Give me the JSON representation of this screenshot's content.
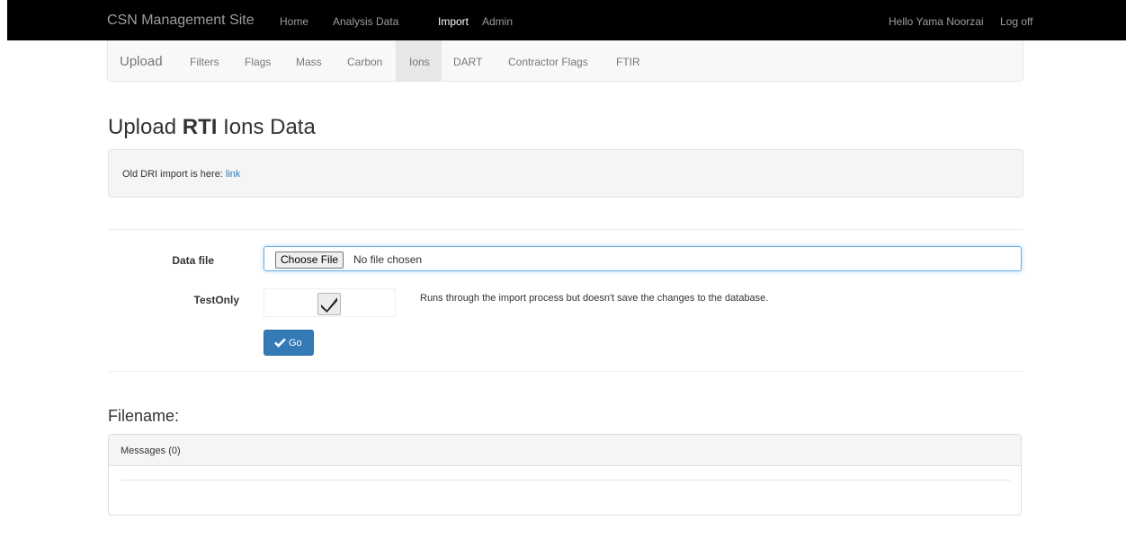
{
  "topbar": {
    "brand": "CSN Management Site",
    "nav": [
      {
        "label": "Home"
      },
      {
        "label": "Analysis Data"
      },
      {
        "label": "Import"
      },
      {
        "label": "Admin"
      }
    ],
    "greeting": "Hello Yama Noorzai",
    "logoff": "Log off",
    "active": "Import"
  },
  "subnav": {
    "brand": "Upload",
    "items": [
      {
        "label": "Filters"
      },
      {
        "label": "Flags"
      },
      {
        "label": "Mass"
      },
      {
        "label": "Carbon"
      },
      {
        "label": "Ions"
      },
      {
        "label": "DART"
      },
      {
        "label": "Contractor Flags"
      },
      {
        "label": "FTIR"
      }
    ],
    "active": "Ions"
  },
  "page": {
    "title_prefix": "Upload ",
    "title_bold": "RTI",
    "title_suffix": " Ions Data",
    "notice_text": "Old DRI import is here: ",
    "notice_link": "link"
  },
  "form": {
    "data_file_label": "Data file",
    "choose_file_label": "Choose File",
    "file_status": "No file chosen",
    "testonly_label": "TestOnly",
    "testonly_checked": true,
    "testonly_help": "Runs through the import process but doesn't save the changes to the database.",
    "go_label": "Go"
  },
  "results": {
    "filename_heading": "Filename:",
    "messages_heading": "Messages (0)"
  },
  "colors": {
    "primary": "#337ab7",
    "navbar": "#000000"
  }
}
